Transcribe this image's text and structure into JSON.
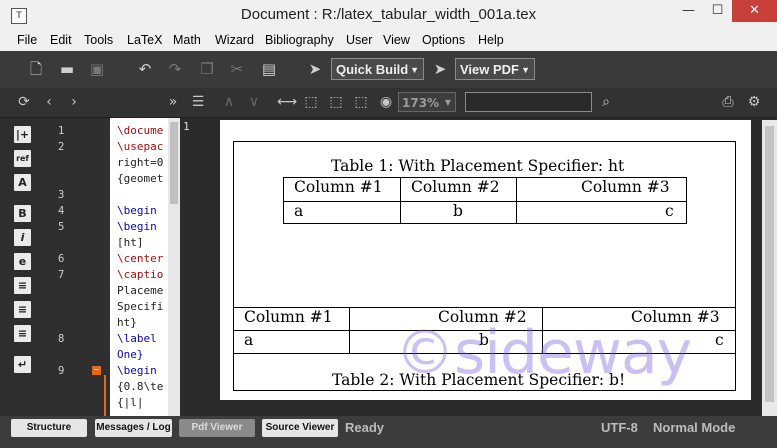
{
  "window": {
    "title": "Document : R:/latex_tabular_width_001a.tex",
    "min": "—",
    "max": "☐",
    "close": "✕"
  },
  "menu": [
    "File",
    "Edit",
    "Tools",
    "LaTeX",
    "Math",
    "Wizard",
    "Bibliography",
    "User",
    "View",
    "Options",
    "Help"
  ],
  "toolbar": {
    "quick_build": "Quick Build",
    "view_pdf": "View PDF"
  },
  "viewer": {
    "zoom": "173%",
    "search_placeholder": ""
  },
  "sidebar": {
    "icons": [
      "|+",
      "ref",
      "A",
      "B",
      "i",
      "e",
      "≡",
      "≡",
      "≡",
      "↵"
    ]
  },
  "editor": {
    "line_numbers": [
      "1",
      "2",
      "3",
      "4",
      "5",
      "6",
      "7",
      "8",
      "9"
    ],
    "lines": [
      {
        "t": "\\docume",
        "c": "red"
      },
      {
        "t": "\\usepac",
        "c": "red"
      },
      {
        "t": "right=0",
        "c": "dark"
      },
      {
        "t": "{geomet",
        "c": "dark"
      },
      {
        "t": "\\begin",
        "c": "blue"
      },
      {
        "t": "\\begin",
        "c": "blue"
      },
      {
        "t": "[ht]",
        "c": "dark"
      },
      {
        "t": "\\center",
        "c": "red"
      },
      {
        "t": "\\captio",
        "c": "red"
      },
      {
        "t": "Placeme",
        "c": "dark"
      },
      {
        "t": "Specifi",
        "c": "dark"
      },
      {
        "t": "ht}",
        "c": "dark"
      },
      {
        "t": "\\label",
        "c": "blue"
      },
      {
        "t": "One}",
        "c": "blue"
      },
      {
        "t": "\\begin",
        "c": "blue"
      },
      {
        "t": "{0.8\\te",
        "c": "dark"
      },
      {
        "t": "{|l|",
        "c": "dark"
      }
    ],
    "fold_marker": "−"
  },
  "pdf": {
    "page_number": "1",
    "table1": {
      "caption": "Table 1: With Placement Specifier: ht",
      "headers": [
        "Column #1",
        "Column #2",
        "Column #3"
      ],
      "row": [
        "a",
        "b",
        "c"
      ]
    },
    "table2": {
      "caption": "Table 2: With Placement Specifier: b!",
      "headers": [
        "Column #1",
        "Column #2",
        "Column #3"
      ],
      "row": [
        "a",
        "b",
        "c"
      ]
    },
    "watermark": "©sideway"
  },
  "status": {
    "tabs": [
      "Structure",
      "Messages / Log",
      "Pdf Viewer",
      "Source Viewer"
    ],
    "active_tab": "Pdf Viewer",
    "state": "Ready",
    "encoding": "UTF-8",
    "mode": "Normal Mode"
  },
  "colors": {
    "accent_orange": "#e06a1c",
    "close_red": "#c7403a",
    "watermark": "#7a5adc"
  }
}
